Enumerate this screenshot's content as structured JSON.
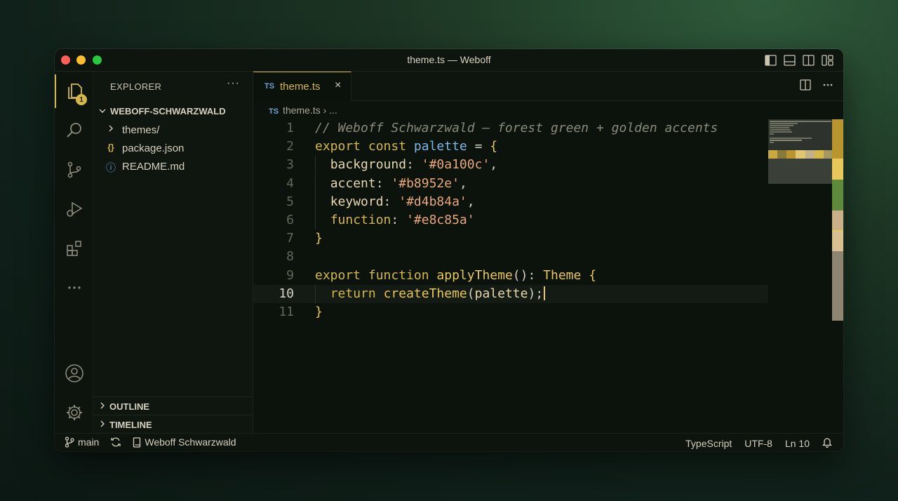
{
  "window": {
    "title": "theme.ts — Weboff"
  },
  "explorer": {
    "header": "EXPLORER",
    "more": "···",
    "folder": "WEBOFF-SCHWARZWALD",
    "items": [
      {
        "label": "themes/",
        "icon": "chevron-right-icon"
      },
      {
        "label": "package.json",
        "icon": "json-icon",
        "glyph": "{}"
      },
      {
        "label": "README.md",
        "icon": "info-icon",
        "glyph": "ⓘ"
      }
    ],
    "sections": [
      "OUTLINE",
      "TIMELINE"
    ],
    "badge": "1"
  },
  "editor": {
    "tab": {
      "lang": "TS",
      "name": "theme.ts",
      "close": "×"
    },
    "breadcrumb": {
      "lang": "TS",
      "file": "theme.ts",
      "sep": "›",
      "rest": "..."
    },
    "current_line": 10,
    "lines": [
      {
        "n": "1",
        "text": "// Weboff Schwarzwald — forest green + golden accents"
      },
      {
        "n": "2",
        "text": "export const palette = {"
      },
      {
        "n": "3",
        "text": "  background: '#0a100c',"
      },
      {
        "n": "4",
        "text": "  accent: '#b8952e',"
      },
      {
        "n": "5",
        "text": "  keyword: '#d4b84a',"
      },
      {
        "n": "6",
        "text": "  function: '#e8c85a'"
      },
      {
        "n": "7",
        "text": "}"
      },
      {
        "n": "8",
        "text": ""
      },
      {
        "n": "9",
        "text": "export function applyTheme(): Theme {"
      },
      {
        "n": "10",
        "text": "  return createTheme(palette);"
      },
      {
        "n": "11",
        "text": "}"
      }
    ]
  },
  "status": {
    "branch": "main",
    "profile": "Weboff Schwarzwald",
    "language": "TypeScript",
    "encoding": "UTF-8",
    "position": "Ln 10"
  },
  "colors": {
    "accent": "#d4b84a",
    "background": "#0c120c",
    "comment": "#8a8a7a",
    "string": "#e8a878",
    "variable": "#7ab8e8"
  }
}
